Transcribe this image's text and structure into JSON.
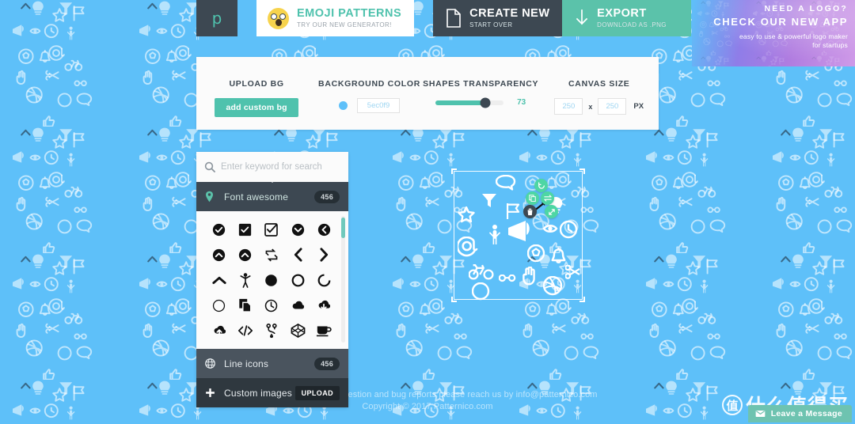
{
  "app": {
    "logo_mark": "p",
    "bg_color_hex": "#5ec0f9",
    "accent_teal": "#4fc2ad",
    "dark_slate": "#3d4852"
  },
  "topbar": {
    "emoji": {
      "icon": "surprised-face-emoji",
      "title": "EMOJI PATTERNS",
      "subtitle": "TRY OUR NEW GENERATOR!"
    },
    "create": {
      "icon": "document-page-icon",
      "title": "CREATE NEW",
      "subtitle": "START OVER"
    },
    "export": {
      "icon": "download-arrow-icon",
      "title": "EXPORT",
      "subtitle": "DOWNLOAD AS .PNG"
    }
  },
  "promo": {
    "line1": "NEED A LOGO?",
    "line2": "CHECK OUR NEW APP",
    "line3": "easy to use & powerful logo maker",
    "line4": "for startups"
  },
  "settings": {
    "upload_bg": {
      "label": "UPLOAD BG",
      "button": "add custom bg"
    },
    "background_color": {
      "label": "BACKGROUND COLOR",
      "value": "5ec0f9",
      "swatch": "#5ec0f9"
    },
    "shapes_transparency": {
      "label": "SHAPES TRANSPARENCY",
      "value": "73",
      "percent": 73
    },
    "canvas_size": {
      "label": "CANVAS SIZE",
      "width": "250",
      "height": "250",
      "separator": "x",
      "unit": "PX"
    }
  },
  "sidebar": {
    "search": {
      "icon": "search-icon",
      "placeholder": "Enter keyword for search",
      "value": ""
    },
    "categories": [
      {
        "icon": "map-pin-icon",
        "label": "Font awesome",
        "count": "456",
        "active": true
      },
      {
        "icon": "globe-icon",
        "label": "Line icons",
        "count": "456",
        "active": false
      },
      {
        "icon": "plus-icon",
        "label": "Custom images",
        "action": "UPLOAD",
        "active": false
      }
    ],
    "icon_grid": [
      "check-circle-icon",
      "check-square-filled-icon",
      "check-square-outline-icon",
      "chevron-down-circle-icon",
      "chevron-left-circle-icon",
      "chevron-up-circle-icon",
      "chevron-up-circle-alt-icon",
      "retweet-icon",
      "chevron-left-icon",
      "chevron-right-icon",
      "chevron-up-icon",
      "child-icon",
      "circle-filled-icon",
      "circle-outline-icon",
      "circle-notch-icon",
      "circle-thin-icon",
      "clone-icon",
      "clock-icon",
      "cloud-icon",
      "cloud-download-icon",
      "cloud-upload-icon",
      "code-icon",
      "code-branch-icon",
      "codepen-icon",
      "coffee-icon"
    ]
  },
  "canvas": {
    "selection_label": "shape-selection-box",
    "tools": [
      {
        "name": "rotate-tool",
        "glyph": "↺"
      },
      {
        "name": "copy-tool",
        "glyph": "❐"
      },
      {
        "name": "flip-tool",
        "glyph": "⇄"
      },
      {
        "name": "delete-tool",
        "glyph": "🗑"
      },
      {
        "name": "resize-tool",
        "glyph": "⤡"
      }
    ]
  },
  "footer": {
    "line1": "For any question, suggestion and bug reports please reach us by info@patternico.com",
    "line2": "Copyright © 2017 Patternico.com"
  },
  "watermark": {
    "badge": "值",
    "text": "什么值得买"
  },
  "chat": {
    "icon": "envelope-icon",
    "label": "Leave a Message"
  }
}
